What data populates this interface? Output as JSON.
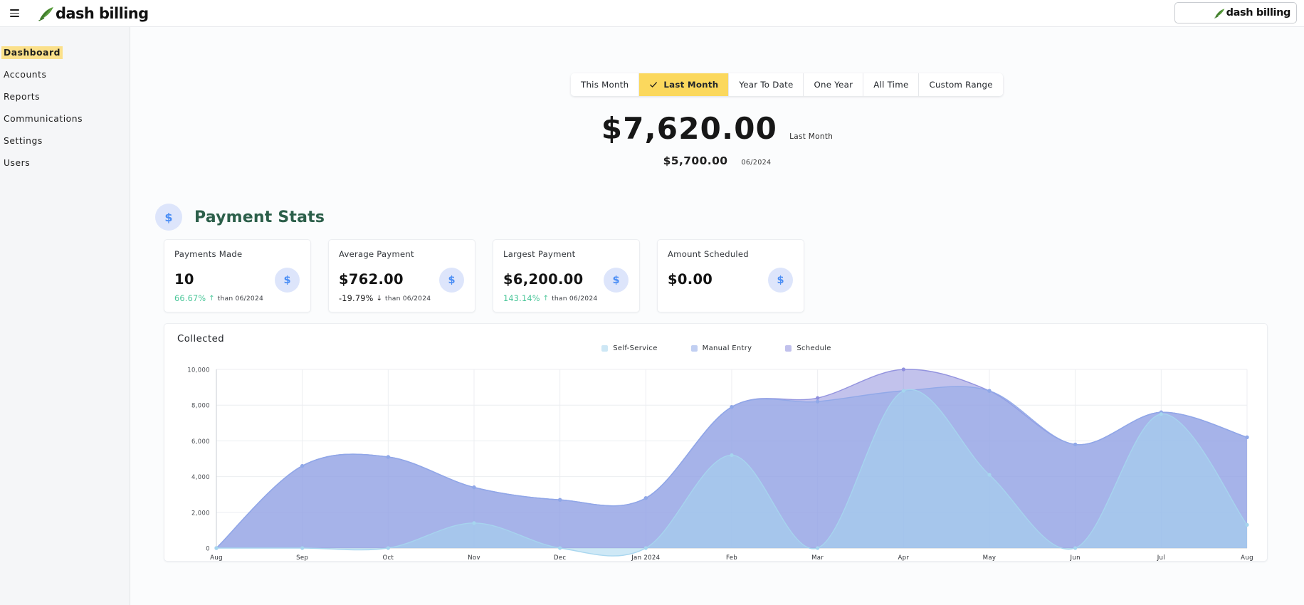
{
  "topbar": {
    "menu_icon": "hamburger-icon",
    "brand_name": "dash billing",
    "logo_box_brand": "dash billing"
  },
  "sidebar": {
    "items": [
      {
        "label": "Dashboard",
        "active": true
      },
      {
        "label": "Accounts",
        "active": false
      },
      {
        "label": "Reports",
        "active": false
      },
      {
        "label": "Communications",
        "active": false
      },
      {
        "label": "Settings",
        "active": false
      },
      {
        "label": "Users",
        "active": false
      }
    ]
  },
  "range_selector": {
    "options": [
      {
        "label": "This Month",
        "active": false
      },
      {
        "label": "Last Month",
        "active": true
      },
      {
        "label": "Year To Date",
        "active": false
      },
      {
        "label": "One Year",
        "active": false
      },
      {
        "label": "All Time",
        "active": false
      },
      {
        "label": "Custom Range",
        "active": false
      }
    ]
  },
  "hero": {
    "amount": "$7,620.00",
    "period_label": "Last Month",
    "compare_amount": "$5,700.00",
    "compare_period": "06/2024"
  },
  "payment_stats": {
    "icon": "dollar-icon",
    "icon_glyph": "$",
    "title": "Payment Stats",
    "cards": [
      {
        "title": "Payments Made",
        "value": "10",
        "delta_pct": "66.67%",
        "delta_dir": "up",
        "delta_arrow": "↑",
        "delta_text": "than 06/2024",
        "icon_glyph": "$"
      },
      {
        "title": "Average Payment",
        "value": "$762.00",
        "delta_pct": "-19.79%",
        "delta_dir": "down",
        "delta_arrow": "↓",
        "delta_text": "than 06/2024",
        "icon_glyph": "$"
      },
      {
        "title": "Largest Payment",
        "value": "$6,200.00",
        "delta_pct": "143.14%",
        "delta_dir": "up",
        "delta_arrow": "↑",
        "delta_text": "than 06/2024",
        "icon_glyph": "$"
      },
      {
        "title": "Amount Scheduled",
        "value": "$0.00",
        "delta_pct": "",
        "delta_dir": "none",
        "delta_arrow": "",
        "delta_text": "",
        "icon_glyph": "$"
      }
    ]
  },
  "colors": {
    "accent_yellow": "#fbd85d",
    "sidebar_highlight": "#fbe08a",
    "brand_green": "#2c5f4a",
    "icon_blue": "#4b8ef5",
    "icon_blue_bg": "#dde5fb",
    "positive_green": "#4cc79a",
    "self_service": "#a5d5ee",
    "manual_entry": "#8fa8e8",
    "schedule": "#8f8fdd"
  },
  "chart_data": {
    "type": "area",
    "title": "Collected",
    "xlabel": "",
    "ylabel": "",
    "ylim": [
      0,
      10000
    ],
    "yticks": [
      "0",
      "2,000",
      "4,000",
      "6,000",
      "8,000",
      "10,000"
    ],
    "grid": true,
    "legend_position": "top-center",
    "categories": [
      "Aug",
      "Sep",
      "Oct",
      "Nov",
      "Dec",
      "Jan 2024",
      "Feb",
      "Mar",
      "Apr",
      "May",
      "Jun",
      "Jul",
      "Aug"
    ],
    "series": [
      {
        "name": "Self-Service",
        "color": "#a5d5ee",
        "values": [
          0,
          0,
          0,
          1400,
          0,
          0,
          5200,
          0,
          8800,
          4100,
          0,
          7500,
          1300
        ]
      },
      {
        "name": "Manual Entry",
        "color": "#8fa8e8",
        "values": [
          0,
          4600,
          5100,
          3400,
          2700,
          2800,
          7900,
          8200,
          8800,
          8800,
          5800,
          7600,
          6200
        ]
      },
      {
        "name": "Schedule",
        "color": "#8f8fdd",
        "values": [
          0,
          4600,
          5100,
          3400,
          2700,
          2800,
          7900,
          8400,
          10000,
          8800,
          5800,
          7600,
          6200
        ]
      }
    ]
  }
}
